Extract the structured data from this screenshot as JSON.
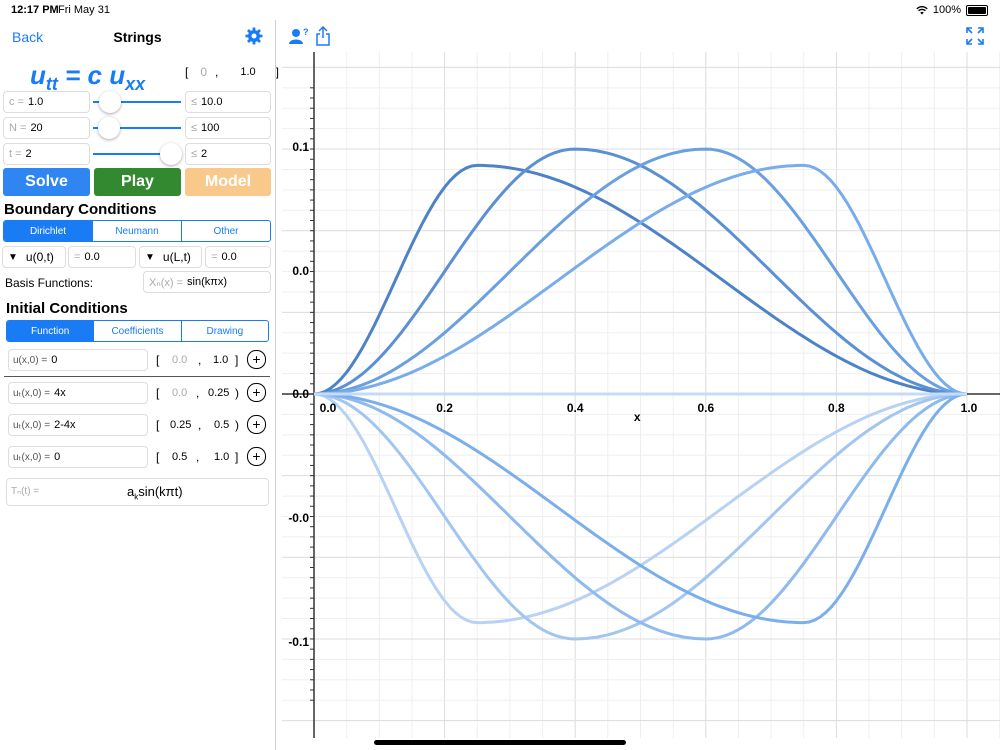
{
  "status": {
    "time": "12:17 PM",
    "date": "Fri May 31",
    "battery": "100%"
  },
  "nav": {
    "back": "Back",
    "title": "Strings"
  },
  "equation": {
    "lhs": "u",
    "lhs_sub": "tt",
    "mid": " = c u",
    "rhs_sub": "xx"
  },
  "domain": {
    "open": "[",
    "from": "0",
    "comma": ",",
    "to": "1.0",
    "close": "]"
  },
  "params": [
    {
      "label": "c =",
      "value": "1.0",
      "max_label": "≤",
      "max": "10.0",
      "fraction": 0.1
    },
    {
      "label": "N =",
      "value": "20",
      "max_label": "≤",
      "max": "100",
      "fraction": 0.2
    },
    {
      "label": "t =",
      "value": "2",
      "max_label": "≤",
      "max": "2",
      "fraction": 1.0
    }
  ],
  "buttons": {
    "solve": "Solve",
    "play": "Play",
    "model": "Model"
  },
  "colors": {
    "accent": "#1a7cf5",
    "solve": "#2f86f2",
    "play": "#32892f",
    "model": "#f8c98a"
  },
  "boundary": {
    "title": "Boundary Conditions",
    "tabs": [
      "Dirichlet",
      "Neumann",
      "Other"
    ],
    "left_select": "u(0,t)",
    "left_eq": "=",
    "left_value": "0.0",
    "right_select": "u(L,t)",
    "right_eq": "=",
    "right_value": "0.0",
    "basis_label": "Basis Functions:",
    "basis_pre": "Xₙ(x) =",
    "basis_value": "sin(kπx)"
  },
  "initial": {
    "title": "Initial Conditions",
    "tabs": [
      "Function",
      "Coefficients",
      "Drawing"
    ],
    "rows": [
      {
        "label": "u(x,0) =",
        "value": "0",
        "a": "0.0",
        "b": "1.0"
      },
      {
        "label": "uₜ(x,0) =",
        "value": "4x",
        "a": "0.0",
        "b": "0.25"
      },
      {
        "label": "uₜ(x,0) =",
        "value": "2-4x",
        "a": "0.25",
        "b": "0.5"
      },
      {
        "label": "uₜ(x,0) =",
        "value": "0",
        "a": "0.5",
        "b": "1.0"
      }
    ],
    "t_pre": "Tₙ(t) =",
    "t_value_a": "a",
    "t_value_k": "k",
    "t_value_rest": "sin(kπt)"
  },
  "plot": {
    "xlabel": "x",
    "x_ticks": [
      "0.0",
      "0.2",
      "0.4",
      "0.6",
      "0.8",
      "1.0"
    ],
    "y_ticks": [
      "0.1",
      "0.0",
      "-0.0",
      "-0.1"
    ],
    "zero_label": "0.0"
  },
  "chart_data": {
    "type": "line",
    "xlabel": "x",
    "ylabel": "",
    "xlim": [
      0,
      1
    ],
    "ylim": [
      -0.175,
      0.19
    ],
    "series": [
      {
        "kind": "bump",
        "peak_x": 0.25,
        "amp": 0.14,
        "color": "#4d82c6"
      },
      {
        "kind": "bump",
        "peak_x": 0.4,
        "amp": 0.15,
        "color": "#5b90d2"
      },
      {
        "kind": "bump",
        "peak_x": 0.6,
        "amp": 0.15,
        "color": "#6aa0e0"
      },
      {
        "kind": "bump",
        "peak_x": 0.75,
        "amp": 0.14,
        "color": "#78aceb"
      },
      {
        "kind": "bump",
        "peak_x": 0.25,
        "amp": -0.14,
        "color": "#b7d2f4"
      },
      {
        "kind": "bump",
        "peak_x": 0.4,
        "amp": -0.15,
        "color": "#a3c6f1"
      },
      {
        "kind": "bump",
        "peak_x": 0.6,
        "amp": -0.15,
        "color": "#8ebaee"
      },
      {
        "kind": "bump",
        "peak_x": 0.75,
        "amp": -0.14,
        "color": "#7bafeb"
      },
      {
        "kind": "flat",
        "peak_x": 0.5,
        "amp": 0,
        "color": "#c6dcf6"
      }
    ]
  }
}
